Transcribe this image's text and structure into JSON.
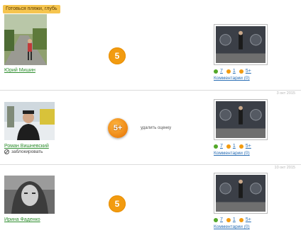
{
  "tooltip": "Готовься пляжи, глубь",
  "entries": [
    {
      "name": "Юрий Мишин",
      "grade": "5",
      "date": "",
      "stats": {
        "green": "7",
        "orange": "1",
        "top": "5+"
      },
      "comments": "Комментарии (0)"
    },
    {
      "name": "Роман Вишневский",
      "grade": "5+",
      "delete_label": "удалить оценку",
      "block_label": "заблокировать",
      "date": "3 окт 2015",
      "stats": {
        "green": "7",
        "orange": "1",
        "top": "5+"
      },
      "comments": "Комментарии (0)"
    },
    {
      "name": "Ирина Фаденко",
      "grade": "5",
      "date": "10 окт 2015",
      "stats": {
        "green": "7",
        "orange": "1",
        "top": "5+"
      },
      "comments": "Комментарии (0)"
    }
  ],
  "colors": {
    "name_link": "#2f8e2f",
    "grade_badge": "#f29b10",
    "stat_link": "#2b6fb5",
    "tooltip_bg": "#f6c54f"
  }
}
